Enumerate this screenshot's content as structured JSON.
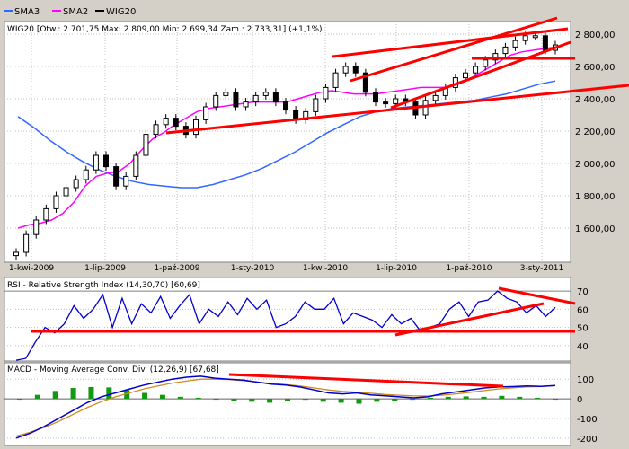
{
  "legend": {
    "items": [
      {
        "label": "SMA3",
        "color": "#3366ff"
      },
      {
        "label": "SMA2",
        "color": "#ff00ff"
      },
      {
        "label": "WIG20",
        "color": "#000000"
      }
    ]
  },
  "colors": {
    "background": "#d4d0c8",
    "panel": "#ffffff",
    "trendline": "#ff0000",
    "candle_up": "#ffffff",
    "candle_down": "#000000",
    "macd_line": "#0000cc",
    "signal_line": "#d08a1e",
    "hist": "#119911"
  },
  "price_panel": {
    "info": "WIG20 [Otw.: 2 701,75  Max: 2 809,00  Min: 2 699,34  Zam.: 2 733,31] (+1,1%)",
    "y_ticks": [
      "2 800,00",
      "2 600,00",
      "2 400,00",
      "2 200,00",
      "2 000,00",
      "1 800,00",
      "1 600,00"
    ],
    "x_ticks": [
      "1-kwi-2009",
      "1-lip-2009",
      "1-paź-2009",
      "1-sty-2010",
      "1-kwi-2010",
      "1-lip-2010",
      "1-paź-2010",
      "3-sty-2011"
    ]
  },
  "rsi_panel": {
    "title": "RSI - Relative Strength Index (14,30,70) [60,69]",
    "y_ticks": [
      "70",
      "60",
      "50",
      "40"
    ]
  },
  "macd_panel": {
    "title": "MACD - Moving Average Conv. Div. (12,26,9) [67,68]",
    "y_ticks": [
      "100",
      "0",
      "-100",
      "-200"
    ]
  },
  "chart_data": [
    {
      "type": "candlestick",
      "title": "WIG20",
      "x_ticks": [
        "1-kwi-2009",
        "1-lip-2009",
        "1-paź-2009",
        "1-sty-2010",
        "1-kwi-2010",
        "1-lip-2010",
        "1-paź-2010",
        "3-sty-2011"
      ],
      "ylim": [
        1400,
        2900
      ],
      "series": [
        {
          "name": "WIG20",
          "close": [
            1450,
            1560,
            1650,
            1720,
            1800,
            1850,
            1900,
            1960,
            2050,
            1980,
            1860,
            1920,
            2050,
            2180,
            2240,
            2280,
            2230,
            2180,
            2270,
            2350,
            2420,
            2440,
            2350,
            2380,
            2420,
            2440,
            2380,
            2330,
            2270,
            2320,
            2400,
            2470,
            2560,
            2600,
            2560,
            2440,
            2380,
            2370,
            2400,
            2380,
            2300,
            2390,
            2420,
            2470,
            2530,
            2560,
            2600,
            2640,
            2680,
            2720,
            2760,
            2790,
            2790,
            2700,
            2733
          ]
        },
        {
          "name": "SMA2",
          "values": [
            1600,
            1620,
            1630,
            1650,
            1690,
            1760,
            1860,
            1920,
            1940,
            1950,
            2000,
            2080,
            2150,
            2190,
            2240,
            2280,
            2320,
            2340,
            2350,
            2360,
            2370,
            2380,
            2380,
            2380,
            2380,
            2400,
            2420,
            2440,
            2450,
            2440,
            2430,
            2430,
            2430,
            2440,
            2450,
            2460,
            2470,
            2470,
            2470,
            2480,
            2510,
            2550,
            2590,
            2630,
            2670,
            2690,
            2700,
            2710,
            2720
          ]
        },
        {
          "name": "SMA3",
          "values": [
            2290,
            2220,
            2140,
            2070,
            2010,
            1960,
            1920,
            1890,
            1870,
            1860,
            1850,
            1850,
            1870,
            1900,
            1930,
            1970,
            2020,
            2070,
            2130,
            2190,
            2240,
            2290,
            2320,
            2340,
            2350,
            2360,
            2370,
            2380,
            2390,
            2410,
            2430,
            2460,
            2490,
            2510
          ]
        }
      ],
      "annotations": [
        "trend lines",
        "support at 2 600"
      ]
    },
    {
      "type": "line",
      "title": "RSI - Relative Strength Index (14,30,70) [60,69]",
      "ylim": [
        30,
        75
      ],
      "levels": [
        70,
        60,
        50,
        40
      ],
      "series": [
        {
          "name": "RSI",
          "values": [
            32,
            33,
            42,
            50,
            47,
            52,
            62,
            55,
            60,
            68,
            50,
            66,
            52,
            63,
            58,
            67,
            55,
            62,
            68,
            52,
            60,
            56,
            64,
            57,
            66,
            60,
            65,
            50,
            52,
            56,
            64,
            60,
            60,
            66,
            52,
            58,
            56,
            54,
            50,
            57,
            52,
            55,
            48,
            50,
            52,
            60,
            64,
            56,
            64,
            65,
            70,
            66,
            64,
            58,
            62,
            56,
            61
          ]
        }
      ]
    },
    {
      "type": "bar+line",
      "title": "MACD - Moving Average Conv. Div. (12,26,9) [67,68]",
      "ylim": [
        -220,
        140
      ],
      "series": [
        {
          "name": "MACD",
          "values": [
            -200,
            -175,
            -140,
            -100,
            -60,
            -20,
            10,
            30,
            50,
            70,
            85,
            100,
            110,
            115,
            105,
            100,
            95,
            85,
            75,
            70,
            60,
            45,
            30,
            25,
            30,
            20,
            15,
            10,
            5,
            10,
            25,
            35,
            45,
            55,
            60,
            62,
            65,
            63,
            68
          ]
        },
        {
          "name": "Signal",
          "values": [
            -190,
            -170,
            -145,
            -115,
            -80,
            -45,
            -15,
            10,
            30,
            50,
            65,
            80,
            90,
            100,
            100,
            98,
            92,
            85,
            78,
            72,
            65,
            55,
            45,
            38,
            33,
            28,
            22,
            18,
            15,
            14,
            18,
            25,
            33,
            42,
            50,
            56,
            60,
            63,
            67
          ]
        },
        {
          "name": "Histogram",
          "values": [
            0,
            20,
            40,
            55,
            60,
            58,
            45,
            30,
            20,
            10,
            5,
            0,
            -10,
            -15,
            -20,
            -10,
            -5,
            -15,
            -20,
            -25,
            -15,
            -10,
            -5,
            5,
            10,
            12,
            10,
            15,
            10,
            5,
            0
          ]
        }
      ]
    }
  ]
}
